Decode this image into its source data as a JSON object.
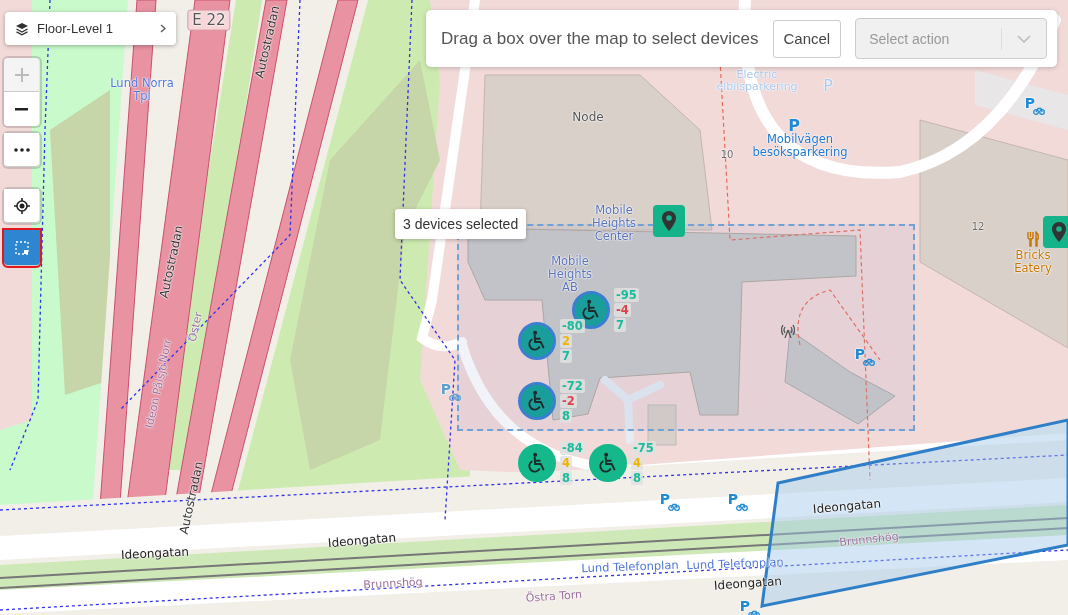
{
  "floor_selector": {
    "label": "Floor-Level 1"
  },
  "map_controls": [
    {
      "kind": "zoom-in",
      "disabled": true,
      "selected": false
    },
    {
      "kind": "zoom-out",
      "disabled": false,
      "selected": false
    },
    {
      "kind": "more",
      "disabled": false,
      "selected": false
    },
    {
      "kind": "locate",
      "disabled": false,
      "selected": false
    },
    {
      "kind": "box-select",
      "disabled": false,
      "selected": true
    }
  ],
  "instruction_bar": {
    "text": "Drag a box over the map to select devices",
    "cancel_label": "Cancel",
    "action_select": {
      "placeholder": "Select action",
      "disabled": true
    }
  },
  "selection": {
    "tooltip": "3 devices selected"
  },
  "map_labels": [
    {
      "kind": "shield",
      "text": "E 22"
    },
    {
      "kind": "road",
      "text": "Autostradan"
    },
    {
      "kind": "road",
      "text": "Autostradan"
    },
    {
      "kind": "road",
      "text": "Autostradan"
    },
    {
      "kind": "station",
      "text": "Lund Norra Tpl"
    },
    {
      "kind": "area",
      "text": "Node"
    },
    {
      "kind": "house-number",
      "text": "10"
    },
    {
      "kind": "house-number",
      "text": "12"
    },
    {
      "kind": "parking-faded",
      "text": "Electric elbilsparkering"
    },
    {
      "kind": "parking-name",
      "text": "Mobilvägen besöksparkering"
    },
    {
      "kind": "building",
      "text": "Mobile Heights Center"
    },
    {
      "kind": "building",
      "text": "Mobile Heights AB"
    },
    {
      "kind": "amenity",
      "text": "Bricks Eatery"
    },
    {
      "kind": "path",
      "text": "Ideon Pålsjö"
    },
    {
      "kind": "path",
      "text": "Norr"
    },
    {
      "kind": "path",
      "text": "Öster"
    },
    {
      "kind": "street",
      "text": "Ideongatan"
    },
    {
      "kind": "street",
      "text": "Ideongatan"
    },
    {
      "kind": "street",
      "text": "Ideongatan"
    },
    {
      "kind": "street",
      "text": "Ideongatan"
    },
    {
      "kind": "path",
      "text": "Brunnshög"
    },
    {
      "kind": "path",
      "text": "Brunnshög"
    },
    {
      "kind": "station",
      "text": "Lund Telefonplan"
    },
    {
      "kind": "station",
      "text": "Lund Telefonplan"
    },
    {
      "kind": "path",
      "text": "Östra Torn"
    },
    {
      "kind": "parking",
      "text": "P"
    },
    {
      "kind": "parking-faded",
      "text": "P"
    },
    {
      "kind": "bike-parking",
      "text": "P"
    },
    {
      "kind": "bike-parking",
      "text": "P"
    },
    {
      "kind": "bike-parking-faded",
      "text": "P"
    },
    {
      "kind": "bike-parking",
      "text": "P"
    },
    {
      "kind": "bike-parking",
      "text": "P"
    },
    {
      "kind": "bike-parking",
      "text": "P"
    }
  ],
  "devices": [
    {
      "selected": true,
      "readings": [
        {
          "text": "-95",
          "color": "#1abc9c"
        },
        {
          "text": "-4",
          "color": "#d9434f"
        },
        {
          "text": "7",
          "color": "#1abc9c"
        }
      ]
    },
    {
      "selected": true,
      "readings": [
        {
          "text": "-80",
          "color": "#1abc9c"
        },
        {
          "text": "2",
          "color": "#f0b400"
        },
        {
          "text": "7",
          "color": "#1abc9c"
        }
      ]
    },
    {
      "selected": true,
      "readings": [
        {
          "text": "-72",
          "color": "#1abc9c"
        },
        {
          "text": "-2",
          "color": "#d9434f"
        },
        {
          "text": "8",
          "color": "#1abc9c"
        }
      ]
    },
    {
      "selected": false,
      "readings": [
        {
          "text": "-84",
          "color": "#1abc9c"
        },
        {
          "text": "4",
          "color": "#f0b400"
        },
        {
          "text": "8",
          "color": "#1abc9c"
        }
      ]
    },
    {
      "selected": false,
      "readings": [
        {
          "text": "-75",
          "color": "#1abc9c"
        },
        {
          "text": "4",
          "color": "#f0b400"
        },
        {
          "text": "8",
          "color": "#1abc9c"
        }
      ]
    }
  ]
}
